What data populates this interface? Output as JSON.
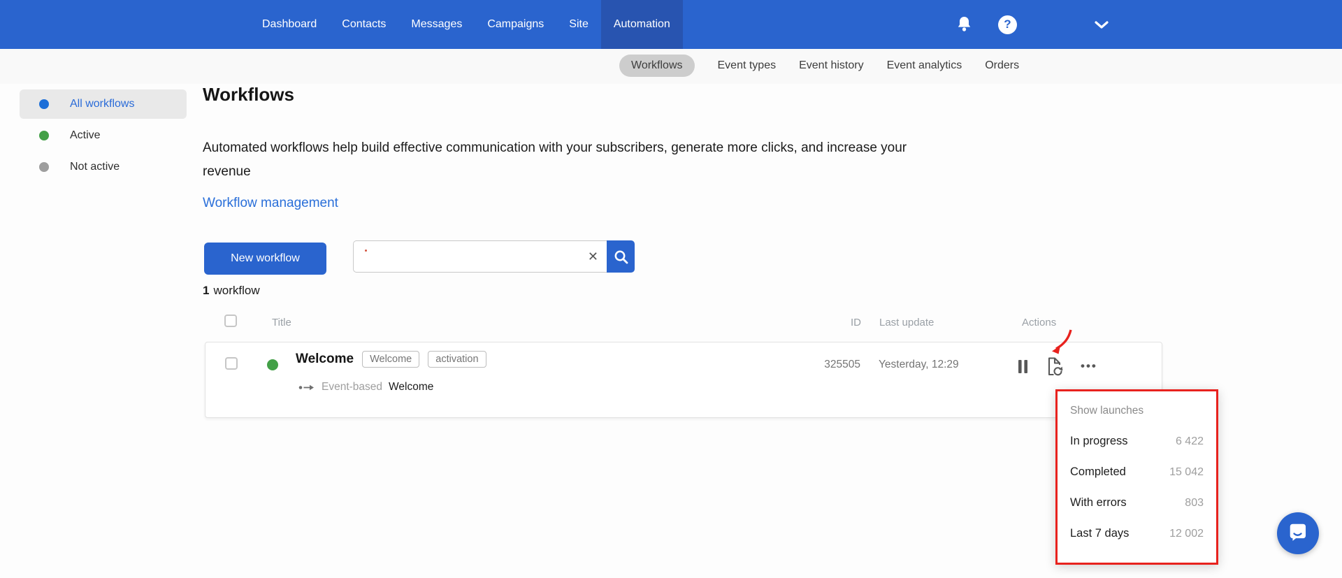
{
  "colors": {
    "header_blue": "#2a64ce",
    "active_tab_blue": "#2854b0",
    "link_blue": "#2a6fd9",
    "status_all": "#1d6fd8",
    "status_active": "#43a047",
    "status_inactive": "#9e9e9e",
    "annotation_red": "#e8221e"
  },
  "icons": {
    "clear_glyph": "✕",
    "more_glyph": "•••",
    "help_glyph": "?"
  },
  "header": {
    "nav_items": [
      {
        "label": "Dashboard"
      },
      {
        "label": "Contacts"
      },
      {
        "label": "Messages"
      },
      {
        "label": "Campaigns"
      },
      {
        "label": "Site"
      },
      {
        "label": "Automation",
        "active": true
      }
    ]
  },
  "subnav": {
    "items": [
      {
        "label": "Workflows",
        "active": true
      },
      {
        "label": "Event types"
      },
      {
        "label": "Event history"
      },
      {
        "label": "Event analytics"
      },
      {
        "label": "Orders"
      }
    ]
  },
  "sidebar": {
    "items": [
      {
        "label": "All workflows",
        "dot_color": "#1d6fd8",
        "active": true
      },
      {
        "label": "Active",
        "dot_color": "#43a047"
      },
      {
        "label": "Not active",
        "dot_color": "#9e9e9e"
      }
    ]
  },
  "main": {
    "title": "Workflows",
    "description": "Automated workflows help build effective communication with your subscribers, generate more clicks, and increase your revenue",
    "management_link": "Workflow management",
    "new_workflow_button": "New workflow",
    "search_value": "",
    "workflow_count": {
      "number": "1",
      "label": "workflow"
    },
    "table": {
      "columns": {
        "title": "Title",
        "id": "ID",
        "last_update": "Last update",
        "actions": "Actions"
      },
      "rows": [
        {
          "title": "Welcome",
          "tags": [
            "Welcome",
            "activation"
          ],
          "status_color": "#43a047",
          "trigger_label": "Event-based",
          "trigger_event": "Welcome",
          "id": "325505",
          "last_update": "Yesterday, 12:29"
        }
      ]
    }
  },
  "launches_popup": {
    "title": "Show launches",
    "stats": [
      {
        "label": "In progress",
        "value": "6 422"
      },
      {
        "label": "Completed",
        "value": "15 042"
      },
      {
        "label": "With errors",
        "value": "803"
      },
      {
        "label": "Last 7 days",
        "value": "12 002"
      }
    ]
  }
}
